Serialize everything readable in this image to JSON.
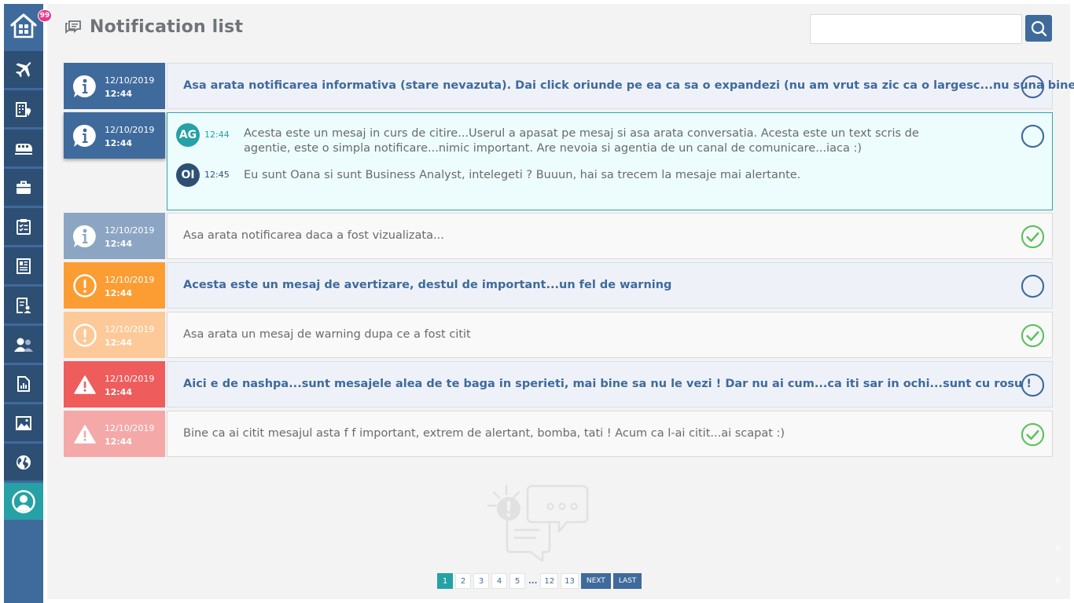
{
  "sidebar": {
    "badge": "99",
    "items": [
      {
        "icon": "airplane-icon",
        "active": false
      },
      {
        "icon": "hotel-building-icon",
        "active": false
      },
      {
        "icon": "train-icon",
        "active": false
      },
      {
        "icon": "briefcase-icon",
        "active": false
      },
      {
        "icon": "checklist-icon",
        "active": false
      },
      {
        "icon": "newspaper-icon",
        "active": false
      },
      {
        "icon": "report-user-icon",
        "active": false
      },
      {
        "icon": "users-icon",
        "active": false
      },
      {
        "icon": "document-chart-icon",
        "active": false
      },
      {
        "icon": "image-gallery-icon",
        "active": false
      },
      {
        "icon": "globe-icon",
        "active": false
      },
      {
        "icon": "user-profile-icon",
        "active": true
      }
    ]
  },
  "header": {
    "title": "Notification list",
    "search_placeholder": ""
  },
  "notifications": [
    {
      "type": "info",
      "read": false,
      "date": "12/10/2019",
      "time": "12:44",
      "text": "Asa arata notificarea informativa (stare nevazuta). Dai click oriunde pe ea ca sa o expandezi (nu am vrut sa zic ca o largesc...nu suna bine )"
    },
    {
      "type": "info",
      "read": false,
      "expanded": true,
      "date": "12/10/2019",
      "time": "12:44",
      "messages": [
        {
          "initials": "AG",
          "time": "12:44",
          "text": "Acesta este un mesaj in curs de citire...Userul a apasat pe mesaj si asa arata conversatia. Acesta este un text scris de agentie, este o simpla notificare...nimic important. Are nevoia si agentia de un canal de comunicare...iaca :)"
        },
        {
          "initials": "OI",
          "time": "12:45",
          "text": "Eu sunt Oana si sunt Business Analyst, intelegeti ? Buuun, hai sa trecem la mesaje mai alertante."
        }
      ]
    },
    {
      "type": "info",
      "read": true,
      "date": "12/10/2019",
      "time": "12:44",
      "text": "Asa arata notificarea daca a fost vizualizata..."
    },
    {
      "type": "warning",
      "read": false,
      "date": "12/10/2019",
      "time": "12:44",
      "text": "Acesta este un mesaj de avertizare, destul de important...un fel de warning"
    },
    {
      "type": "warning",
      "read": true,
      "date": "12/10/2019",
      "time": "12:44",
      "text": "Asa arata un mesaj de warning dupa ce a fost citit"
    },
    {
      "type": "danger",
      "read": false,
      "date": "12/10/2019",
      "time": "12:44",
      "text": "Aici e de nashpa...sunt mesajele alea de te baga in sperieti, mai bine sa nu le vezi ! Dar nu ai cum...ca iti sar in ochi...sunt cu rosu !"
    },
    {
      "type": "danger",
      "read": true,
      "date": "12/10/2019",
      "time": "12:44",
      "text": "Bine ca ai citit mesajul asta f f important, extrem de alertant, bomba, tati ! Acum ca l-ai citit...ai scapat :)"
    }
  ],
  "pagination": {
    "pages": [
      "1",
      "2",
      "3",
      "4",
      "5"
    ],
    "ellipsis": "...",
    "tail_pages": [
      "12",
      "13"
    ],
    "current": "1",
    "next_label": "NEXT",
    "last_label": "LAST"
  },
  "colors": {
    "primary": "#3f6a9c",
    "teal": "#26a1a6",
    "warning": "#fb9d33",
    "danger": "#ee5c5c",
    "success": "#5cc15c",
    "badge": "#e8388a"
  }
}
